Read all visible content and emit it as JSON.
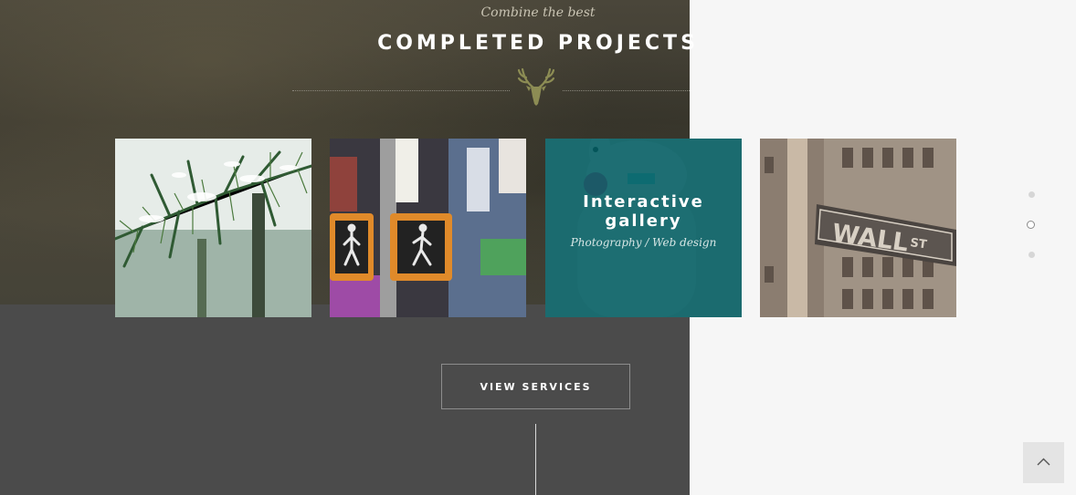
{
  "section": {
    "kicker": "Combine the best",
    "title": "COMPLETED PROJECTS"
  },
  "portfolio": {
    "items": [
      {
        "id": "pine-branch",
        "icon": "pine-branch-image"
      },
      {
        "id": "crosswalk-signal",
        "icon": "crosswalk-signal-image"
      },
      {
        "id": "interactive-gallery",
        "icon": "bunny-costume-image",
        "overlay_title": "Interactive gallery",
        "categories": "Photography / Web design"
      },
      {
        "id": "wall-street",
        "icon": "wall-street-sign-image"
      }
    ],
    "overlay_color": "#005c62"
  },
  "pagination": {
    "count": 3,
    "active_index": 1
  },
  "cta": {
    "label": "VIEW SERVICES"
  },
  "scroll_top": {
    "icon": "chevron-up-icon"
  },
  "colors": {
    "left_panel": "#4b4b4b",
    "right_panel": "#f6f6f6",
    "accent": "#8a8a5a"
  }
}
